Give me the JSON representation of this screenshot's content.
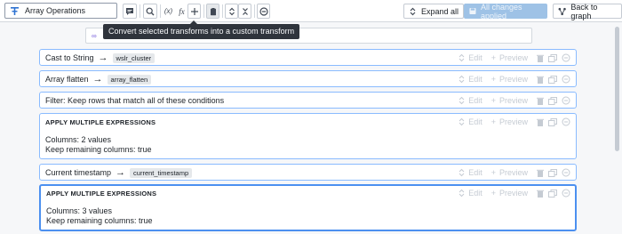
{
  "toolbar": {
    "path_value": "Array Operations",
    "expand_all": "Expand all",
    "all_changes_applied": "All changes applied",
    "back_to_graph": "Back to graph",
    "formula_x_label": "(x)",
    "formula_fx_label": "fx"
  },
  "tooltip": {
    "text": "Convert selected transforms into a custom transform"
  },
  "actions": {
    "edit": "Edit",
    "preview": "Preview"
  },
  "transforms": [
    {
      "type": "cast",
      "title": "Cast to String",
      "arrow": "→",
      "output": "wslr_cluster"
    },
    {
      "type": "cast",
      "title": "Array flatten",
      "arrow": "→",
      "output": "array_flatten"
    },
    {
      "type": "filter",
      "title": "Filter:  Keep rows that match all of these conditions"
    },
    {
      "type": "multi",
      "title": "APPLY MULTIPLE EXPRESSIONS",
      "columns": "Columns:  2 values",
      "keep": "Keep remaining columns:  true"
    },
    {
      "type": "cast",
      "title": "Current timestamp",
      "arrow": "→",
      "output": "current_timestamp"
    },
    {
      "type": "multi",
      "title": "APPLY MULTIPLE EXPRESSIONS",
      "columns": "Columns:  3 values",
      "keep": "Keep remaining columns:  true"
    }
  ],
  "colors": {
    "accent": "#2d72d2",
    "selected_border": "#4c90f0",
    "card_border": "#8abbff",
    "tooltip_bg": "#2f343c",
    "disabled_button": "#9ec2e6"
  }
}
